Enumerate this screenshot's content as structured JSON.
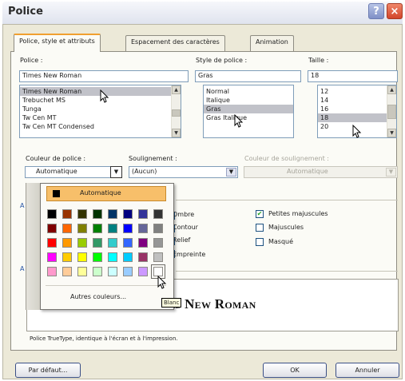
{
  "window": {
    "title": "Police",
    "help_label": "?",
    "close_label": "×"
  },
  "tabs": [
    {
      "label": "Police, style et attributs",
      "active": true
    },
    {
      "label": "Espacement des caractères",
      "active": false
    },
    {
      "label": "Animation",
      "active": false
    }
  ],
  "font": {
    "label": "Police :",
    "value": "Times New Roman",
    "list": [
      "Times New Roman",
      "Trebuchet MS",
      "Tunga",
      "Tw Cen MT",
      "Tw Cen MT Condensed"
    ],
    "selected_index": 0
  },
  "style": {
    "label": "Style de police :",
    "value": "Gras",
    "list": [
      "Normal",
      "Italique",
      "Gras",
      "Gras Italique"
    ],
    "selected_index": 2
  },
  "size": {
    "label": "Taille :",
    "value": "18",
    "list": [
      "12",
      "14",
      "16",
      "18",
      "20"
    ],
    "selected_index": 3
  },
  "font_color": {
    "label": "Couleur de police :",
    "value": "Automatique"
  },
  "underline": {
    "label": "Soulignement :",
    "value": "(Aucun)"
  },
  "underline_color": {
    "label": "Couleur de soulignement :",
    "value": "Automatique"
  },
  "color_popup": {
    "automatic_label": "Automatique",
    "automatic_color": "#000000",
    "more_colors_label": "Autres couleurs...",
    "tooltip": "Blanc",
    "swatches": [
      "#000000",
      "#993300",
      "#333300",
      "#003300",
      "#003366",
      "#000080",
      "#333399",
      "#333333",
      "#800000",
      "#ff6600",
      "#808000",
      "#008000",
      "#008080",
      "#0000ff",
      "#666699",
      "#808080",
      "#ff0000",
      "#ff9900",
      "#99cc00",
      "#339966",
      "#33cccc",
      "#3366ff",
      "#800080",
      "#969696",
      "#ff00ff",
      "#ffcc00",
      "#ffff00",
      "#00ff00",
      "#00ffff",
      "#00ccff",
      "#993366",
      "#c0c0c0",
      "#ff99cc",
      "#ffcc99",
      "#ffff99",
      "#ccffcc",
      "#ccffff",
      "#99ccff",
      "#cc99ff",
      "#ffffff"
    ],
    "highlighted_index": 39
  },
  "effects": {
    "col2": [
      {
        "label": "Ombre",
        "checked": false
      },
      {
        "label": "Contour",
        "checked": false
      },
      {
        "label": "Relief",
        "checked": false
      },
      {
        "label": "Empreinte",
        "checked": false
      }
    ],
    "col3": [
      {
        "label": "Petites majuscules",
        "checked": true
      },
      {
        "label": "Majuscules",
        "checked": false
      },
      {
        "label": "Masqué",
        "checked": false
      }
    ]
  },
  "preview": {
    "sample": "Times New Roman",
    "note": "Police TrueType, identique à l'écran et à l'impression."
  },
  "buttons": {
    "default": "Par défaut...",
    "ok": "OK",
    "cancel": "Annuler"
  }
}
